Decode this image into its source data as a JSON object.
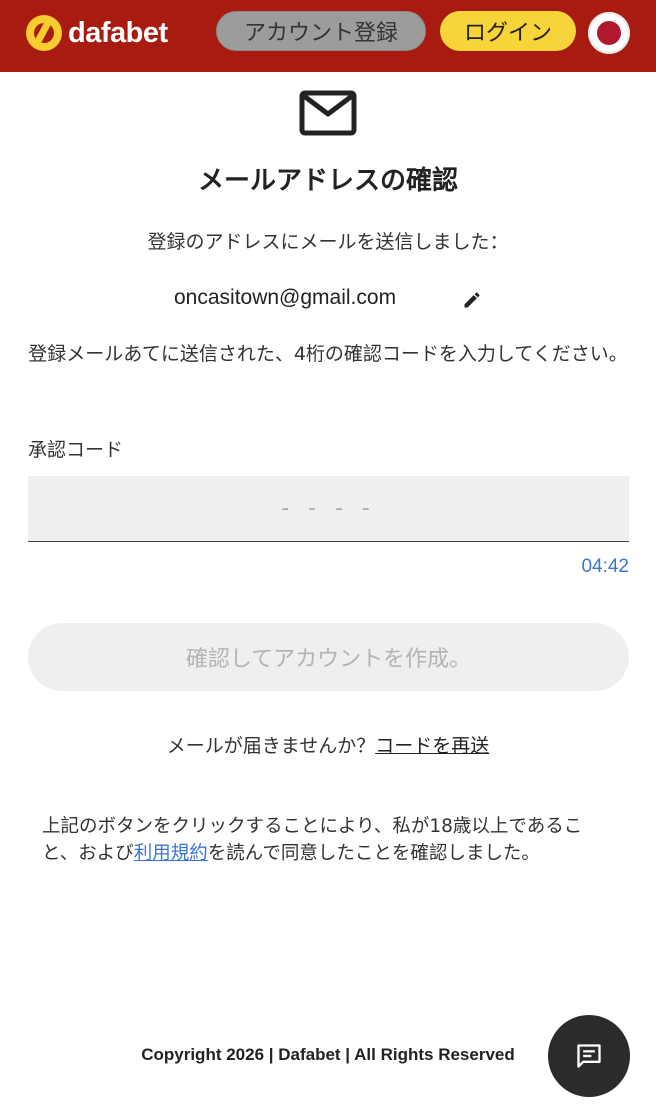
{
  "header": {
    "logo_text": "dafabet",
    "register_label": "アカウント登録",
    "login_label": "ログイン",
    "language_flag": "japan-flag-icon",
    "brand_color": "#a81b10",
    "login_color": "#f6d43a"
  },
  "main": {
    "icon": "mail-icon",
    "title": "メールアドレスの確認",
    "sent_message": "登録のアドレスにメールを送信しました：",
    "email": "oncasitown@gmail.com",
    "edit_icon": "pencil-icon",
    "instructions": "登録メールあてに送信された、4桁の確認コードを入力してください。",
    "code_label": "承認コード",
    "code_placeholder": "- - - -",
    "code_value": "",
    "timer": "04:42",
    "confirm_button": "確認してアカウントを作成。",
    "resend_prompt": "メールが届きませんか？",
    "resend_link": "コードを再送",
    "consent_before": "上記のボタンをクリックすることにより、私が18歳以上であること、および",
    "consent_link": "利用規約",
    "consent_after": "を読んで同意したことを確認しました。",
    "link_color": "#3a75d8"
  },
  "footer": {
    "copyright": "Copyright 2026 | Dafabet | All Rights Reserved",
    "chat_icon": "chat-icon"
  }
}
